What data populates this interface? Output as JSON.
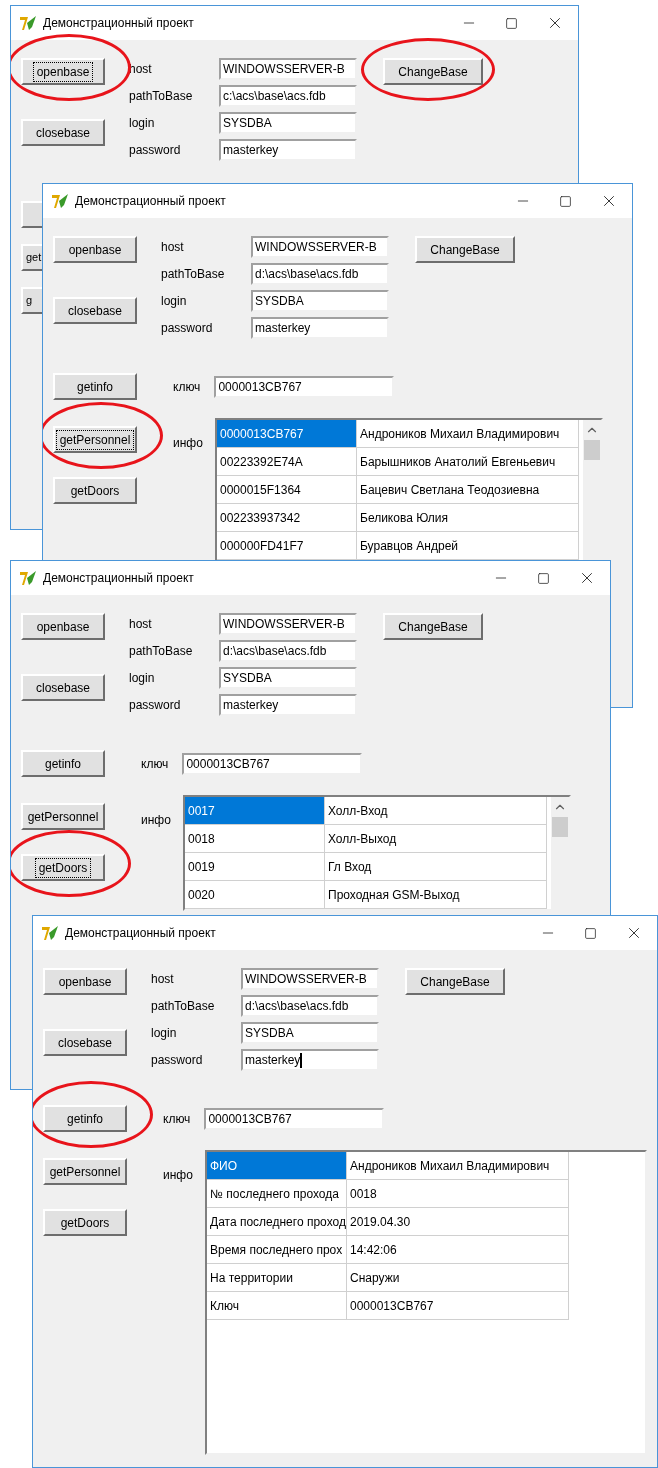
{
  "windows": [
    {
      "title": "Демонстрационный проект",
      "top_buttons": [
        {
          "label": "openbase",
          "focused": true,
          "circled": true
        },
        {
          "label": "closebase",
          "focused": false,
          "circled": false
        }
      ],
      "fields": [
        {
          "label": "host",
          "value": "WINDOWSSERVER-B",
          "focused": false
        },
        {
          "label": "pathToBase",
          "value": "c:\\acs\\base\\acs.fdb",
          "focused": false
        },
        {
          "label": "login",
          "value": "SYSDBA",
          "focused": false
        },
        {
          "label": "password",
          "value": "masterkey",
          "focused": false
        }
      ],
      "change_base": {
        "label": "ChangeBase",
        "focused": false,
        "circled": true
      },
      "cut_buttons": [
        {
          "label": "get"
        },
        {
          "label": "g"
        }
      ]
    },
    {
      "title": "Демонстрационный проект",
      "top_buttons": [
        {
          "label": "openbase",
          "focused": false,
          "circled": false
        },
        {
          "label": "closebase",
          "focused": false,
          "circled": false
        }
      ],
      "fields": [
        {
          "label": "host",
          "value": "WINDOWSSERVER-B",
          "focused": false
        },
        {
          "label": "pathToBase",
          "value": "d:\\acs\\base\\acs.fdb",
          "focused": false
        },
        {
          "label": "login",
          "value": "SYSDBA",
          "focused": false
        },
        {
          "label": "password",
          "value": "masterkey",
          "focused": false
        }
      ],
      "change_base": {
        "label": "ChangeBase",
        "focused": false,
        "circled": false
      },
      "get_info": {
        "label": "getinfo",
        "focused": false,
        "circled": false
      },
      "key": {
        "label": "ключ",
        "value": "0000013CB767"
      },
      "bottom_buttons": [
        {
          "label": "getPersonnel",
          "focused": true,
          "circled": true
        },
        {
          "label": "getDoors",
          "focused": false,
          "circled": false
        }
      ],
      "info": {
        "label": "инфо",
        "scrollbar": true,
        "fill": false,
        "rows": [
          {
            "cells": [
              {
                "text": "0000013CB767",
                "selected": true
              },
              {
                "text": "Андроников Михаил Владимирович",
                "selected": false
              }
            ]
          },
          {
            "cells": [
              {
                "text": "00223392E74A",
                "selected": false
              },
              {
                "text": "Барышников Анатолий Евгеньевич",
                "selected": false
              }
            ]
          },
          {
            "cells": [
              {
                "text": "0000015F1364",
                "selected": false
              },
              {
                "text": "Бацевич Светлана Теодозиевна",
                "selected": false
              }
            ]
          },
          {
            "cells": [
              {
                "text": "002233937342",
                "selected": false
              },
              {
                "text": "Беликова Юлия",
                "selected": false
              }
            ]
          },
          {
            "cells": [
              {
                "text": "000000FD41F7",
                "selected": false
              },
              {
                "text": "Буравцов Андрей",
                "selected": false
              }
            ]
          }
        ]
      }
    },
    {
      "title": "Демонстрационный проект",
      "top_buttons": [
        {
          "label": "openbase",
          "focused": false,
          "circled": false
        },
        {
          "label": "closebase",
          "focused": false,
          "circled": false
        }
      ],
      "fields": [
        {
          "label": "host",
          "value": "WINDOWSSERVER-B",
          "focused": false
        },
        {
          "label": "pathToBase",
          "value": "d:\\acs\\base\\acs.fdb",
          "focused": false
        },
        {
          "label": "login",
          "value": "SYSDBA",
          "focused": false
        },
        {
          "label": "password",
          "value": "masterkey",
          "focused": false
        }
      ],
      "change_base": {
        "label": "ChangeBase",
        "focused": false,
        "circled": false
      },
      "get_info": {
        "label": "getinfo",
        "focused": false,
        "circled": false
      },
      "key": {
        "label": "ключ",
        "value": "0000013CB767"
      },
      "bottom_buttons": [
        {
          "label": "getPersonnel",
          "focused": false,
          "circled": false
        },
        {
          "label": "getDoors",
          "focused": true,
          "circled": true
        }
      ],
      "info": {
        "label": "инфо",
        "scrollbar": true,
        "fill": false,
        "rows": [
          {
            "cells": [
              {
                "text": "0017",
                "selected": true
              },
              {
                "text": "Холл-Вход",
                "selected": false
              }
            ]
          },
          {
            "cells": [
              {
                "text": "0018",
                "selected": false
              },
              {
                "text": "Холл-Выход",
                "selected": false
              }
            ]
          },
          {
            "cells": [
              {
                "text": "0019",
                "selected": false
              },
              {
                "text": "Гл Вход",
                "selected": false
              }
            ]
          },
          {
            "cells": [
              {
                "text": "0020",
                "selected": false
              },
              {
                "text": "Проходная GSM-Выход",
                "selected": false
              }
            ]
          }
        ]
      }
    },
    {
      "title": "Демонстрационный проект",
      "top_buttons": [
        {
          "label": "openbase",
          "focused": false,
          "circled": false
        },
        {
          "label": "closebase",
          "focused": false,
          "circled": false
        }
      ],
      "fields": [
        {
          "label": "host",
          "value": "WINDOWSSERVER-B",
          "focused": false
        },
        {
          "label": "pathToBase",
          "value": "d:\\acs\\base\\acs.fdb",
          "focused": false
        },
        {
          "label": "login",
          "value": "SYSDBA",
          "focused": false
        },
        {
          "label": "password",
          "value": "masterkey",
          "focused": true
        }
      ],
      "change_base": {
        "label": "ChangeBase",
        "focused": false,
        "circled": false
      },
      "get_info": {
        "label": "getinfo",
        "focused": false,
        "circled": true
      },
      "key": {
        "label": "ключ",
        "value": "0000013CB767"
      },
      "bottom_buttons": [
        {
          "label": "getPersonnel",
          "focused": false,
          "circled": false
        },
        {
          "label": "getDoors",
          "focused": false,
          "circled": false
        }
      ],
      "info": {
        "label": "инфо",
        "scrollbar": false,
        "fill": true,
        "rows": [
          {
            "cells": [
              {
                "text": "ФИО",
                "selected": true
              },
              {
                "text": "Андроников Михаил Владимирович",
                "selected": false
              }
            ]
          },
          {
            "cells": [
              {
                "text": "№ последнего прохода",
                "selected": false
              },
              {
                "text": "0018",
                "selected": false
              }
            ]
          },
          {
            "cells": [
              {
                "text": "Дата последнего проход",
                "selected": false
              },
              {
                "text": "2019.04.30",
                "selected": false
              }
            ]
          },
          {
            "cells": [
              {
                "text": "Время последнего прох",
                "selected": false
              },
              {
                "text": "14:42:06",
                "selected": false
              }
            ]
          },
          {
            "cells": [
              {
                "text": "На территории",
                "selected": false
              },
              {
                "text": "Снаружи",
                "selected": false
              }
            ]
          },
          {
            "cells": [
              {
                "text": "Ключ",
                "selected": false
              },
              {
                "text": "0000013CB767",
                "selected": false
              }
            ]
          }
        ]
      }
    }
  ]
}
